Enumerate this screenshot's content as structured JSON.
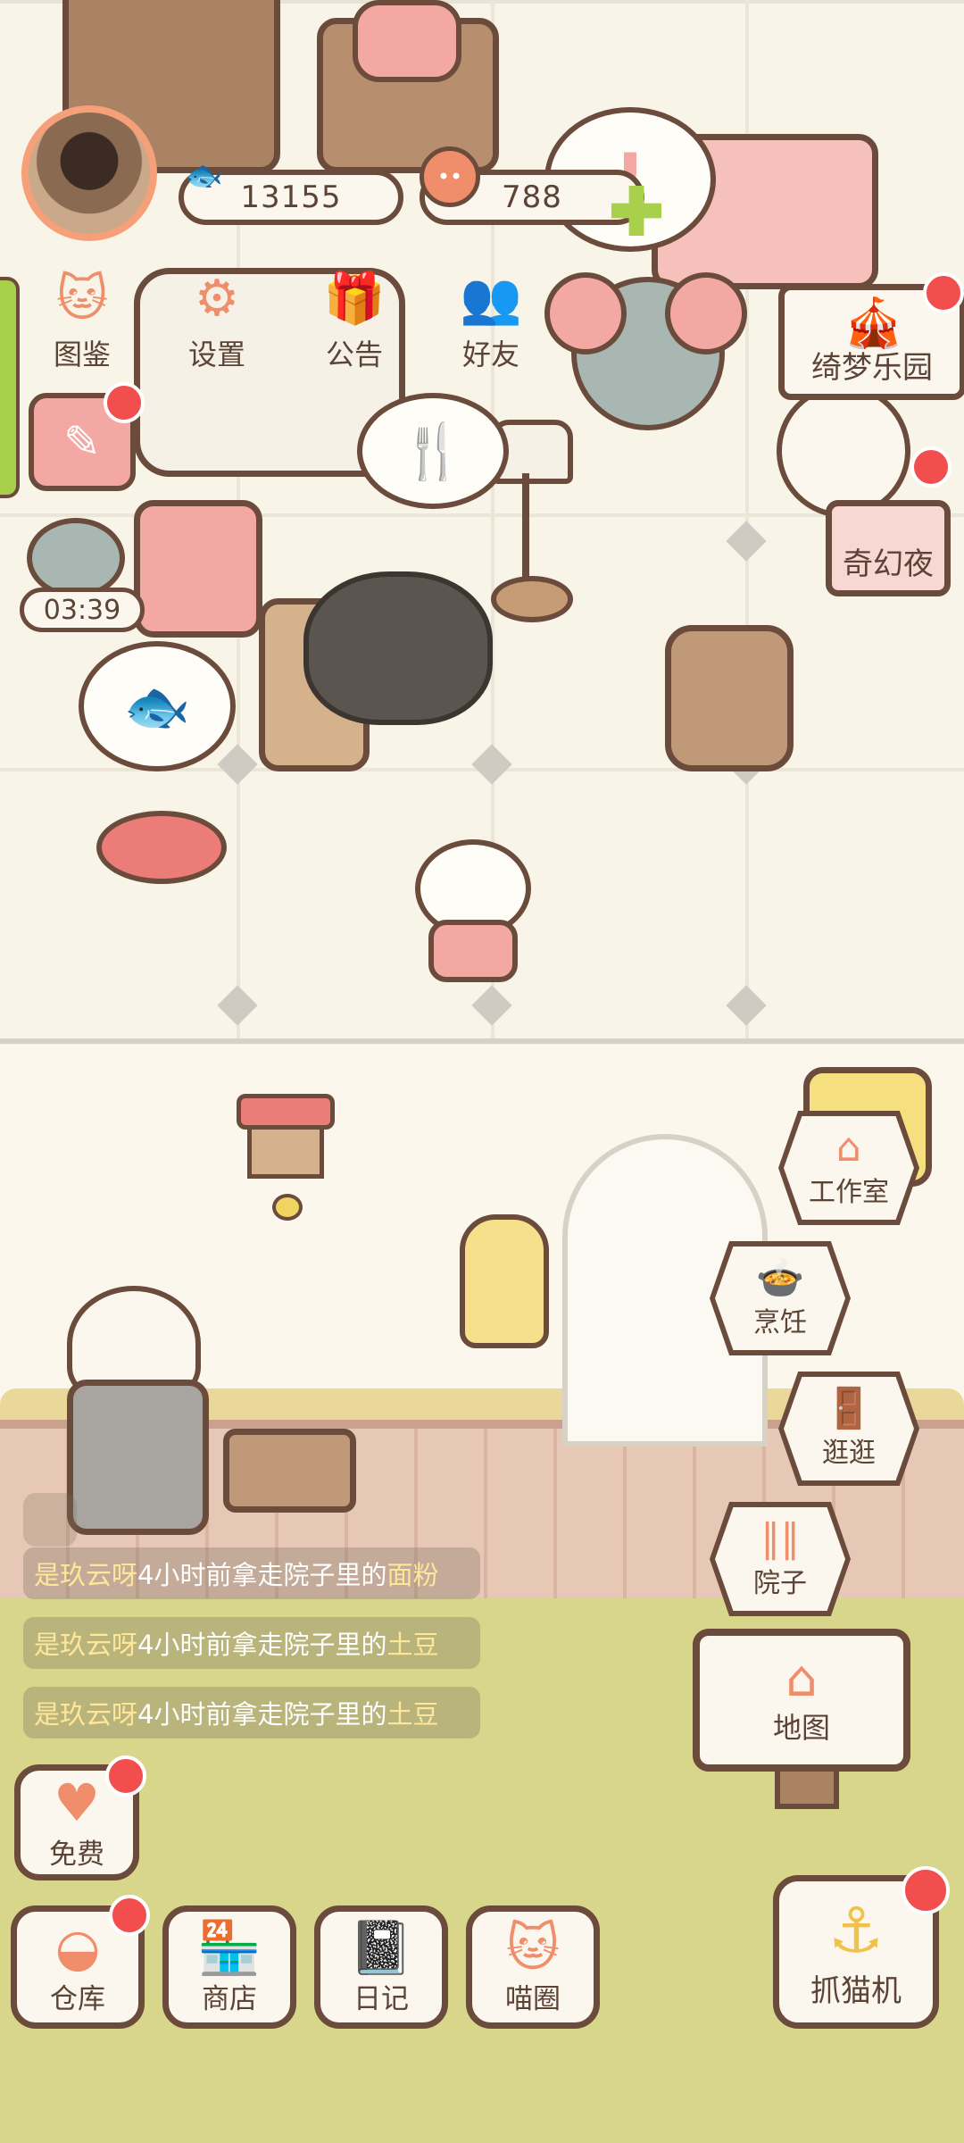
{
  "hud": {
    "fish_currency": "13155",
    "heart_currency": "788",
    "fish_icon": "fish-icon",
    "heart_icon": "heart-face-icon"
  },
  "top_menu": [
    {
      "id": "handbook",
      "label": "图鉴",
      "icon": "cat-book-icon"
    },
    {
      "id": "settings",
      "label": "设置",
      "icon": "gear-icon"
    },
    {
      "id": "notice",
      "label": "公告",
      "icon": "gift-icon"
    },
    {
      "id": "friends",
      "label": "好友",
      "icon": "friends-icon"
    }
  ],
  "events": {
    "dream_park": "绮梦乐园",
    "fantasy_night": "奇幻夜"
  },
  "room": {
    "mouse_timer": "03:39"
  },
  "yard_buttons": {
    "workshop": "工作室",
    "cooking": "烹饪",
    "stroll": "逛逛",
    "yard": "院子",
    "map": "地图"
  },
  "feed": [
    {
      "user": "是玖云呀",
      "middle": "4小时前拿走院子里的",
      "item": "面粉"
    },
    {
      "user": "是玖云呀",
      "middle": "4小时前拿走院子里的",
      "item": "土豆"
    },
    {
      "user": "是玖云呀",
      "middle": "4小时前拿走院子里的",
      "item": "土豆"
    }
  ],
  "bottom": {
    "free": "免费",
    "warehouse": "仓库",
    "shop": "商店",
    "diary": "日记",
    "meow_circle": "喵圈",
    "claw_machine": "抓猫机"
  },
  "colors": {
    "accent": "#f08d6a",
    "outline": "#6a4b3c",
    "badge": "#f24e4e",
    "plus": "#a9d04a"
  }
}
